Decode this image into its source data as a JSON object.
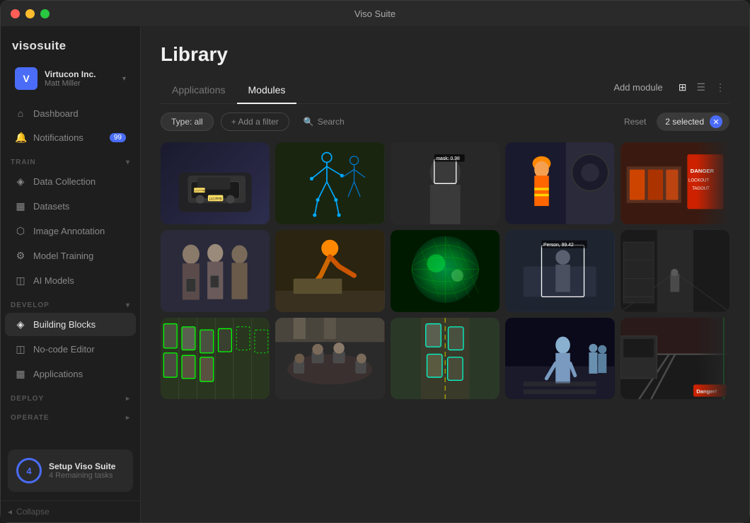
{
  "app": {
    "title": "Viso Suite"
  },
  "sidebar": {
    "logo": "visosuite",
    "user": {
      "name": "Virtucon Inc.",
      "email": "Matt Miller",
      "avatar_letter": "V"
    },
    "nav": [
      {
        "id": "dashboard",
        "label": "Dashboard",
        "icon": "⌂",
        "badge": null
      },
      {
        "id": "notifications",
        "label": "Notifications",
        "icon": "🔔",
        "badge": "99"
      }
    ],
    "sections": [
      {
        "label": "TRAIN",
        "items": [
          {
            "id": "data-collection",
            "label": "Data Collection",
            "icon": "◈"
          },
          {
            "id": "datasets",
            "label": "Datasets",
            "icon": "▦"
          },
          {
            "id": "image-annotation",
            "label": "Image Annotation",
            "icon": "⬡"
          },
          {
            "id": "model-training",
            "label": "Model Training",
            "icon": "⚙"
          },
          {
            "id": "ai-models",
            "label": "AI Models",
            "icon": "◫"
          }
        ]
      },
      {
        "label": "DEVELOP",
        "items": [
          {
            "id": "building-blocks",
            "label": "Building Blocks",
            "icon": "◈",
            "active": true
          },
          {
            "id": "no-code-editor",
            "label": "No-code Editor",
            "icon": "◫"
          },
          {
            "id": "applications",
            "label": "Applications",
            "icon": "▦"
          }
        ]
      },
      {
        "label": "DEPLOY",
        "items": []
      },
      {
        "label": "OPERATE",
        "items": []
      }
    ],
    "setup": {
      "number": "4",
      "title": "Setup Viso Suite",
      "subtitle": "4 Remaining tasks"
    },
    "collapse_label": "Collapse"
  },
  "page": {
    "title": "Library",
    "tabs": [
      {
        "id": "applications",
        "label": "Applications",
        "active": false
      },
      {
        "id": "modules",
        "label": "Modules",
        "active": true
      }
    ],
    "actions": {
      "add_module": "Add module"
    },
    "filters": {
      "type_label": "Type: all",
      "add_filter": "+ Add a filter",
      "search": "Search",
      "reset": "Reset",
      "selected": "2 selected"
    },
    "grid": {
      "items": [
        {
          "id": 1,
          "type": "car-detection",
          "row": 1,
          "col": 1
        },
        {
          "id": 2,
          "type": "pose-estimation",
          "row": 1,
          "col": 2
        },
        {
          "id": 3,
          "type": "face-mask",
          "row": 1,
          "col": 3
        },
        {
          "id": 4,
          "type": "ppe-detection",
          "row": 1,
          "col": 4
        },
        {
          "id": 5,
          "type": "lockout-tagout",
          "row": 1,
          "col": 5
        },
        {
          "id": 6,
          "type": "people-group",
          "row": 2,
          "col": 1
        },
        {
          "id": 7,
          "type": "worker-inspection",
          "row": 2,
          "col": 2
        },
        {
          "id": 8,
          "type": "thermal-map",
          "row": 2,
          "col": 3
        },
        {
          "id": 9,
          "type": "person-detection",
          "row": 2,
          "col": 4
        },
        {
          "id": 10,
          "type": "industrial",
          "row": 2,
          "col": 5
        },
        {
          "id": 11,
          "type": "parking-detection",
          "row": 3,
          "col": 1
        },
        {
          "id": 12,
          "type": "meeting-room",
          "row": 3,
          "col": 2
        },
        {
          "id": 13,
          "type": "traffic-vehicles",
          "row": 3,
          "col": 3
        },
        {
          "id": 14,
          "type": "pedestrian-crossing",
          "row": 3,
          "col": 4
        },
        {
          "id": 15,
          "type": "rail-safety",
          "row": 3,
          "col": 5
        }
      ]
    }
  }
}
